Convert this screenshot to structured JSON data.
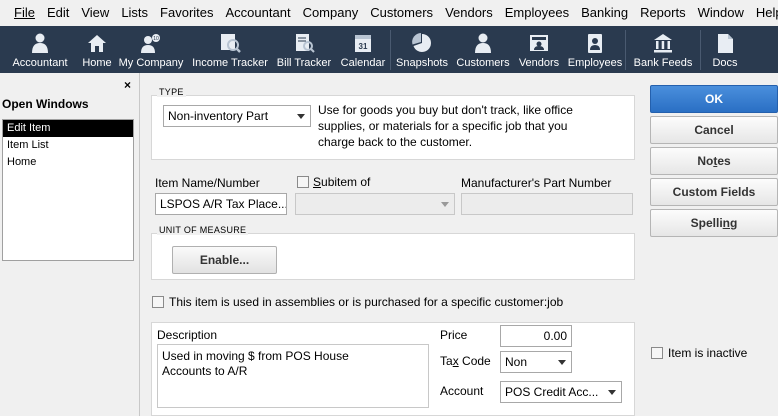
{
  "menu": [
    "Edit",
    "View",
    "Lists",
    "Favorites",
    "Accountant",
    "Company",
    "Customers",
    "Vendors",
    "Employees",
    "Banking",
    "Reports",
    "Window",
    "Help"
  ],
  "menu_file": "File",
  "iconbar": {
    "accountant": "Accountant",
    "home": "Home",
    "my_company": "My Company",
    "income_tracker": "Income Tracker",
    "bill_tracker": "Bill Tracker",
    "calendar": "Calendar",
    "snapshots": "Snapshots",
    "customers": "Customers",
    "vendors": "Vendors",
    "employees": "Employees",
    "bank_feeds": "Bank Feeds",
    "docs": "Docs"
  },
  "open_windows": {
    "close": "×",
    "title": "Open Windows",
    "items": [
      "Edit Item",
      "Item List",
      "Home"
    ]
  },
  "type_section": {
    "label": "TYPE",
    "selected": "Non-inventory Part",
    "description": [
      "Use for goods you buy but don't track, like office",
      "supplies, or materials for a specific job that you",
      "charge back to the customer."
    ]
  },
  "item_name": {
    "label": "Item Name/Number",
    "value": "LSPOS A/R Tax Place..."
  },
  "subitem": {
    "label_u": "S",
    "label_rest": "ubitem of",
    "value": ""
  },
  "manufacturer": {
    "label": "Manufacturer's Part Number",
    "value": ""
  },
  "uom": {
    "label": "UNIT OF MEASURE",
    "button": "Enable..."
  },
  "assemblies_checkbox": "This item is used in assemblies or is purchased for a specific customer:job",
  "description": {
    "label": "Description",
    "lines": [
      "Used in moving $ from POS House",
      "Accounts to A/R"
    ]
  },
  "price": {
    "label": "Price",
    "value": "0.00"
  },
  "tax_code": {
    "label_pre": "Ta",
    "label_u": "x",
    "label_post": " Code",
    "value": "Non"
  },
  "account": {
    "label": "Account",
    "value": "POS Credit Acc..."
  },
  "buttons": {
    "ok": "OK",
    "cancel": "Cancel",
    "notes_pre": "No",
    "notes_u": "t",
    "notes_post": "es",
    "custom_fields": "Custom Fields",
    "spelling_pre": "Spelli",
    "spelling_u": "n",
    "spelling_post": "g"
  },
  "inactive_checkbox": "Item is inactive",
  "colors": {
    "iconbar_bg": "#2a3a4f",
    "ok_button": "#2a6fc4",
    "selection": "#000000"
  }
}
